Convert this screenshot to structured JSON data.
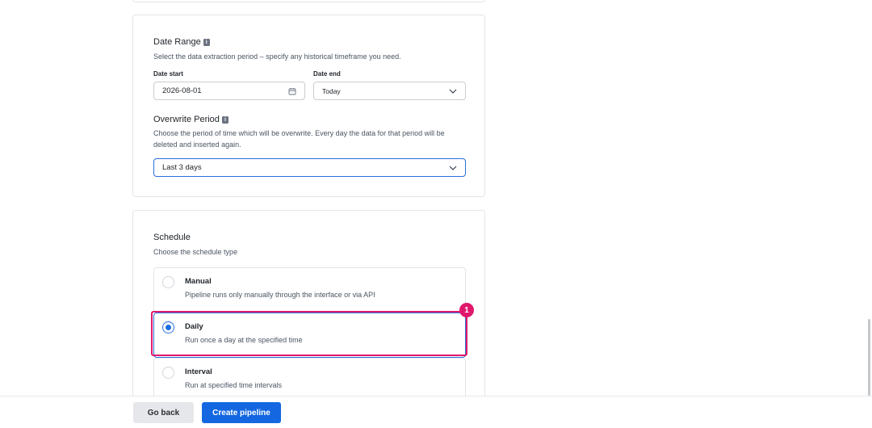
{
  "date_range": {
    "title": "Date Range",
    "description": "Select the data extraction period – specify any historical timeframe you need.",
    "date_start_label": "Date start",
    "date_start_value": "2026-08-01",
    "date_end_label": "Date end",
    "date_end_value": "Today"
  },
  "overwrite_period": {
    "title": "Overwrite Period",
    "description": "Choose the period of time which will be overwrite. Every day the data for that period will be deleted and inserted again.",
    "value": "Last 3 days"
  },
  "schedule": {
    "title": "Schedule",
    "description": "Choose the schedule type",
    "options": [
      {
        "title": "Manual",
        "description": "Pipeline runs only manually through the interface or via API",
        "selected": false
      },
      {
        "title": "Daily",
        "description": "Run once a day at the specified time",
        "selected": true
      },
      {
        "title": "Interval",
        "description": "Run at specified time intervals",
        "selected": false
      }
    ]
  },
  "annotation": {
    "badge": "1"
  },
  "footer": {
    "back_label": "Go back",
    "create_label": "Create pipeline"
  },
  "colors": {
    "primary": "#1467e0",
    "highlight": "#e0186c"
  }
}
